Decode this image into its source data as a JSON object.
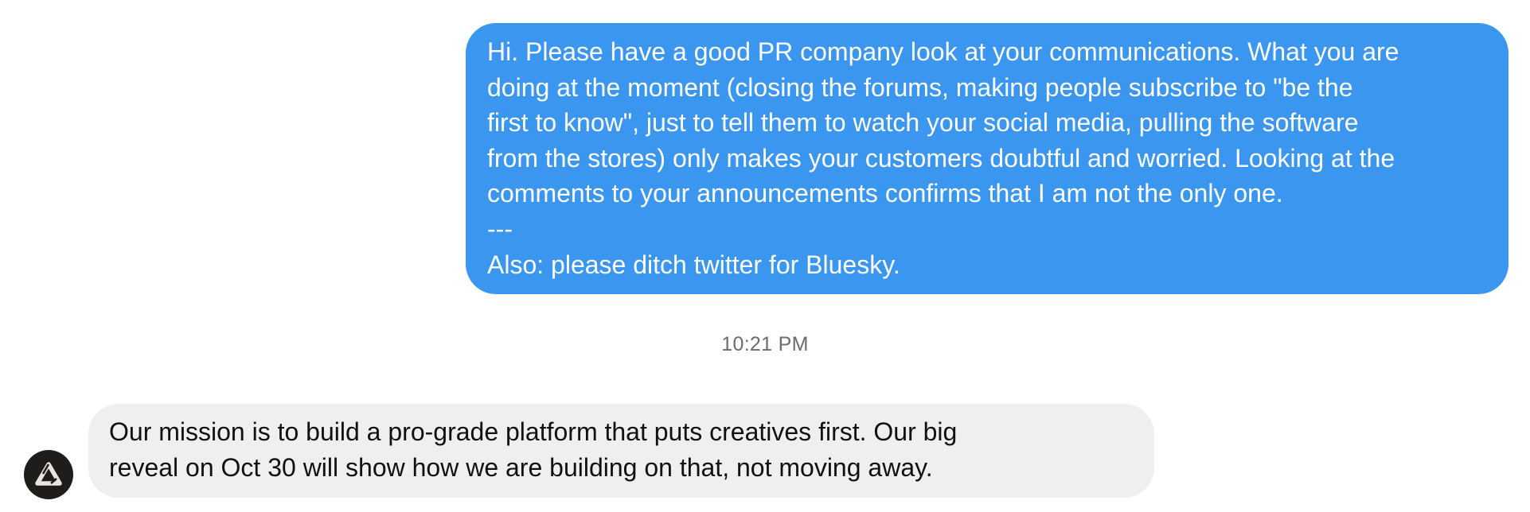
{
  "conversation": {
    "outgoing_message": {
      "text": "Hi. Please have a good PR company look at your communications. What you are\ndoing at the moment (closing the forums, making people subscribe to \"be the\nfirst to know\", just to tell them to watch your social media, pulling the software\nfrom the stores) only makes your customers doubtful and worried. Looking at the\ncomments to your announcements confirms that I am not the only one.\n---\nAlso: please ditch twitter for Bluesky."
    },
    "timestamp": "10:21 PM",
    "incoming_message": {
      "avatar_icon": "affinity-logo-icon",
      "text": "Our mission is to build a pro-grade platform that puts creatives first. Our big\nreveal on Oct 30 will show how we are building on that, not moving away."
    }
  },
  "colors": {
    "outgoing_bubble": "#3b96ef",
    "outgoing_text": "#ffffff",
    "incoming_bubble": "#efefef",
    "incoming_text": "#111111",
    "timestamp_text": "#6c6c70",
    "avatar_background": "#1f1d1c"
  }
}
